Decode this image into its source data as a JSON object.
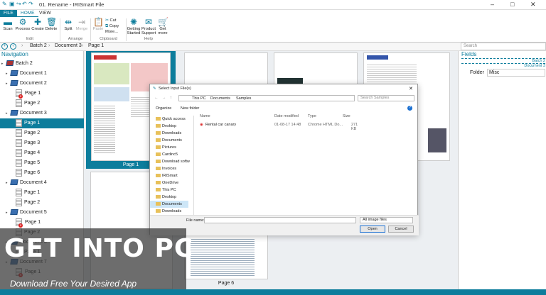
{
  "app": {
    "title": "01. Rename - IRISmart File",
    "accent": "#0d7d9c"
  },
  "tabs": [
    "FILE",
    "HOME",
    "VIEW"
  ],
  "ribbon": {
    "buttons": [
      "Scan",
      "Process",
      "Create",
      "Delete",
      "Split",
      "Merge",
      "Paste",
      "Getting Started",
      "Product Support",
      "Get more"
    ],
    "clipboard": {
      "cut": "Cut",
      "copy": "Copy",
      "more": "More..."
    },
    "groups": [
      "Edit",
      "Arrange",
      "Clipboard",
      "Help"
    ]
  },
  "breadcrumb": [
    "Batch 2",
    "Document 3",
    "Page 1"
  ],
  "search": {
    "placeholder": "Search"
  },
  "navigation": {
    "title": "Navigation",
    "items": [
      {
        "label": "Batch 2",
        "type": "batch"
      },
      {
        "label": "Document 1",
        "type": "doc"
      },
      {
        "label": "Document 2",
        "type": "doc"
      },
      {
        "label": "Page 1",
        "type": "page",
        "error": true
      },
      {
        "label": "Page 2",
        "type": "page"
      },
      {
        "label": "Document 3",
        "type": "doc"
      },
      {
        "label": "Page 1",
        "type": "page",
        "selected": true
      },
      {
        "label": "Page 2",
        "type": "page"
      },
      {
        "label": "Page 3",
        "type": "page"
      },
      {
        "label": "Page 4",
        "type": "page"
      },
      {
        "label": "Page 5",
        "type": "page"
      },
      {
        "label": "Page 6",
        "type": "page"
      },
      {
        "label": "Document 4",
        "type": "doc"
      },
      {
        "label": "Page 1",
        "type": "page"
      },
      {
        "label": "Page 2",
        "type": "page"
      },
      {
        "label": "Document 5",
        "type": "doc"
      },
      {
        "label": "Page 1",
        "type": "page",
        "error": true
      },
      {
        "label": "Page 2",
        "type": "page"
      },
      {
        "label": "Document 6",
        "type": "doc"
      },
      {
        "label": "Page 1",
        "type": "page"
      },
      {
        "label": "Document 7",
        "type": "doc"
      },
      {
        "label": "Page 1",
        "type": "page",
        "error": true
      }
    ]
  },
  "content": {
    "captions": [
      "Page 1",
      "Page 6"
    ]
  },
  "fields": {
    "title": "Fields",
    "batch_label": "Batch 2",
    "doc_label": "Document 3",
    "folder_label": "Folder",
    "folder_value": "Misc"
  },
  "dialog": {
    "title": "Select Input File(s)",
    "path": [
      "This PC",
      "Documents",
      "Samples"
    ],
    "search_placeholder": "Search Samples",
    "organize": "Organize",
    "new_folder": "New folder",
    "quick": [
      "Quick access",
      "Desktop",
      "Downloads",
      "Documents",
      "Pictures",
      "Cardinc5",
      "Download softw",
      "Invoices",
      "IRISmart",
      "OneDrive",
      "This PC",
      "Desktop",
      "Documents",
      "Downloads"
    ],
    "columns": [
      "Name",
      "Date modified",
      "Type",
      "Size"
    ],
    "files": [
      {
        "name": "Rental car canary",
        "date": "01-08-17 14:48",
        "type": "Chrome HTML Do...",
        "size": "271 KB"
      }
    ],
    "filename_label": "File name:",
    "filter": "All image files",
    "open": "Open",
    "cancel": "Cancel"
  },
  "watermark": {
    "line1": "GET INTO PC",
    "line2": "Download Free Your Desired App"
  }
}
